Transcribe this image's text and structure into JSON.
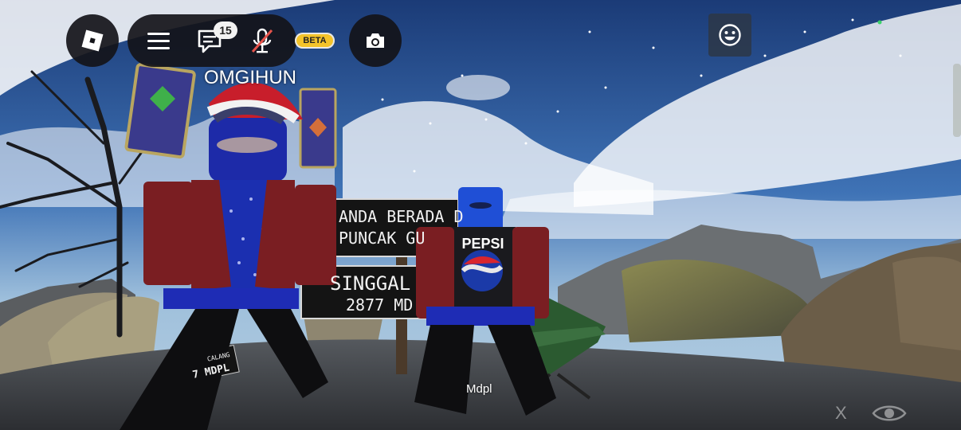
{
  "hud": {
    "menu_icon": "roblox-logo-icon",
    "chat_count": "15",
    "mic_state": "muted",
    "beta_label": "BETA",
    "colors": {
      "hud_bg": "#141419",
      "beta_bg": "#f4c32b",
      "muted_mic": "#e5534b"
    }
  },
  "players": {
    "player1_name": "OMGIHUN",
    "player2_name": "Mdpl"
  },
  "signs": {
    "top_line1": "ANDA BERADA D",
    "top_line2": "PUNCAK GU",
    "bottom_line1": "SINGGAL",
    "bottom_line2": "2877 MD",
    "small_line1": "CALANG",
    "small_line2": "7 MDPL"
  },
  "controls": {
    "x_label": "X"
  }
}
